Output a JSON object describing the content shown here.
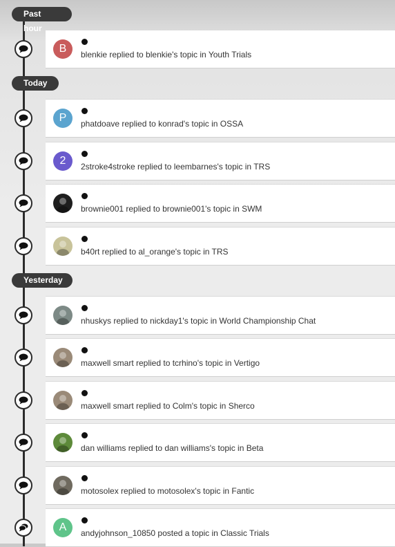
{
  "groups": [
    {
      "label": "Past hour",
      "items": [
        {
          "text": "blenkie replied to blenkie's topic in Youth Trials",
          "avatar": {
            "type": "letter",
            "letter": "B",
            "color": "#c95c5c"
          },
          "icon": "comment-icon"
        }
      ]
    },
    {
      "label": "Today",
      "items": [
        {
          "text": "phatdoave replied to konrad's topic in OSSA",
          "avatar": {
            "type": "letter",
            "letter": "P",
            "color": "#5ba4cf"
          },
          "icon": "comment-icon"
        },
        {
          "text": "2stroke4stroke replied to leembarnes's topic in TRS",
          "avatar": {
            "type": "letter",
            "letter": "2",
            "color": "#6a5acd"
          },
          "icon": "comment-icon"
        },
        {
          "text": "brownie001 replied to brownie001's topic in SWM",
          "avatar": {
            "type": "photo",
            "color": "#1e1e1e"
          },
          "icon": "comment-icon"
        },
        {
          "text": "b40rt replied to al_orange's topic in TRS",
          "avatar": {
            "type": "photo",
            "color": "#c8c39a"
          },
          "icon": "comment-icon"
        }
      ]
    },
    {
      "label": "Yesterday",
      "items": [
        {
          "text": "nhuskys replied to nickday1's topic in World Championship Chat",
          "avatar": {
            "type": "photo",
            "color": "#7d8a86"
          },
          "icon": "comment-icon"
        },
        {
          "text": "maxwell smart replied to tcrhino's topic in Vertigo",
          "avatar": {
            "type": "photo",
            "color": "#9a8a78"
          },
          "icon": "comment-icon"
        },
        {
          "text": "maxwell smart replied to Colm's topic in Sherco",
          "avatar": {
            "type": "photo",
            "color": "#9a8a78"
          },
          "icon": "comment-icon"
        },
        {
          "text": "dan williams replied to dan williams's topic in Beta",
          "avatar": {
            "type": "photo",
            "color": "#5d8a3a"
          },
          "icon": "comment-icon"
        },
        {
          "text": "motosolex replied to motosolex's topic in Fantic",
          "avatar": {
            "type": "photo",
            "color": "#6f6a5f"
          },
          "icon": "comment-icon"
        },
        {
          "text": "andyjohnson_10850 posted a topic in Classic Trials",
          "avatar": {
            "type": "letter",
            "letter": "A",
            "color": "#5fc48a"
          },
          "icon": "comments-icon"
        }
      ]
    }
  ]
}
